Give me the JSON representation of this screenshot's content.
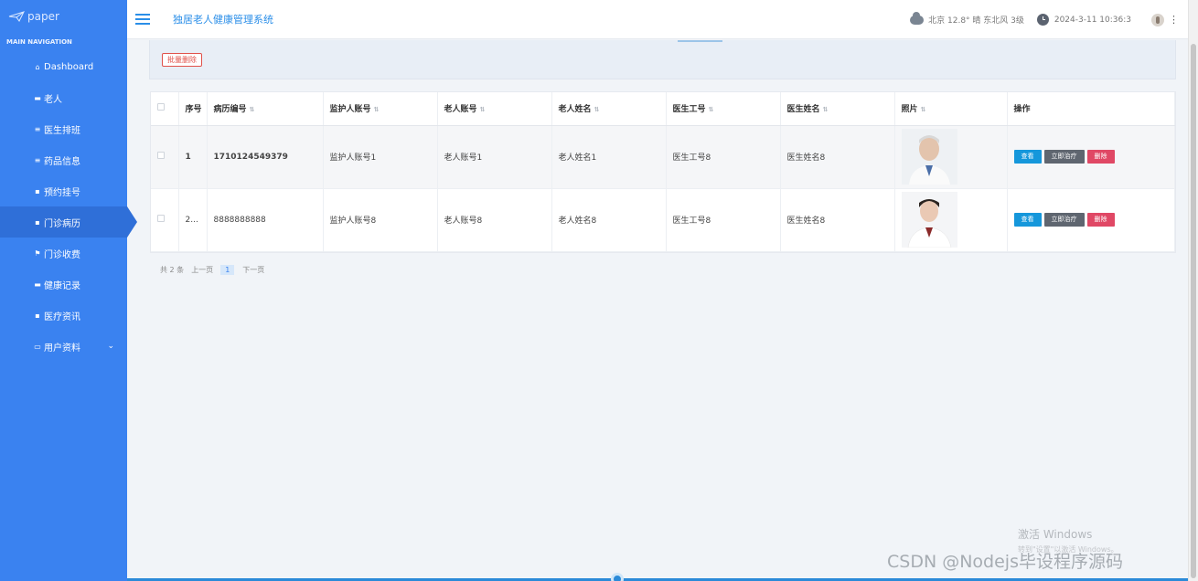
{
  "brand": {
    "logo_text": "paper"
  },
  "nav": {
    "header": "MAIN NAVIGATION",
    "items": [
      {
        "label": "Dashboard",
        "icon": "home-icon",
        "glyph": "⌂"
      },
      {
        "label": "老人",
        "icon": "id-card-icon",
        "glyph": "▬"
      },
      {
        "label": "医生排班",
        "icon": "list-icon",
        "glyph": "≡"
      },
      {
        "label": "药品信息",
        "icon": "list-icon",
        "glyph": "≡"
      },
      {
        "label": "预约挂号",
        "icon": "grid-icon",
        "glyph": "▪"
      },
      {
        "label": "门诊病历",
        "icon": "grid-icon",
        "glyph": "▪"
      },
      {
        "label": "门诊收费",
        "icon": "flag-icon",
        "glyph": "⚑"
      },
      {
        "label": "健康记录",
        "icon": "chat-icon",
        "glyph": "▬"
      },
      {
        "label": "医疗资讯",
        "icon": "grid-icon",
        "glyph": "▪"
      },
      {
        "label": "用户资料",
        "icon": "user-card-icon",
        "glyph": "▭"
      }
    ],
    "active_index": 5
  },
  "header": {
    "title": "独居老人健康管理系统",
    "weather": "北京 12.8° 晴 东北风 3级",
    "datetime": "2024-3-11 10:36:3"
  },
  "toolbar": {
    "batch_delete": "批量删除"
  },
  "table": {
    "columns": [
      "序号",
      "病历编号",
      "监护人账号",
      "老人账号",
      "老人姓名",
      "医生工号",
      "医生姓名",
      "照片",
      "操作"
    ],
    "rows": [
      {
        "index": "1",
        "record_no": "1710124549379",
        "guardian": "监护人账号1",
        "elder_account": "老人账号1",
        "elder_name": "老人姓名1",
        "doctor_no": "医生工号8",
        "doctor_name": "医生姓名8"
      },
      {
        "index": "2...",
        "record_no": "8888888888",
        "guardian": "监护人账号8",
        "elder_account": "老人账号8",
        "elder_name": "老人姓名8",
        "doctor_no": "医生工号8",
        "doctor_name": "医生姓名8"
      }
    ],
    "actions": {
      "view": "查看",
      "treat": "立即治疗",
      "delete": "删除"
    }
  },
  "pager": {
    "total": "共 2 条",
    "prev": "上一页",
    "current": "1",
    "next": "下一页"
  },
  "watermarks": {
    "windows_title": "激活 Windows",
    "windows_sub": "转到\"设置\"以激活 Windows。",
    "csdn": "CSDN @Nodejs毕设程序源码"
  },
  "colors": {
    "sidebar": "#3a82f0",
    "accent": "#2a8ee8",
    "view": "#1597db",
    "treat": "#5f6670",
    "delete": "#e04865"
  }
}
